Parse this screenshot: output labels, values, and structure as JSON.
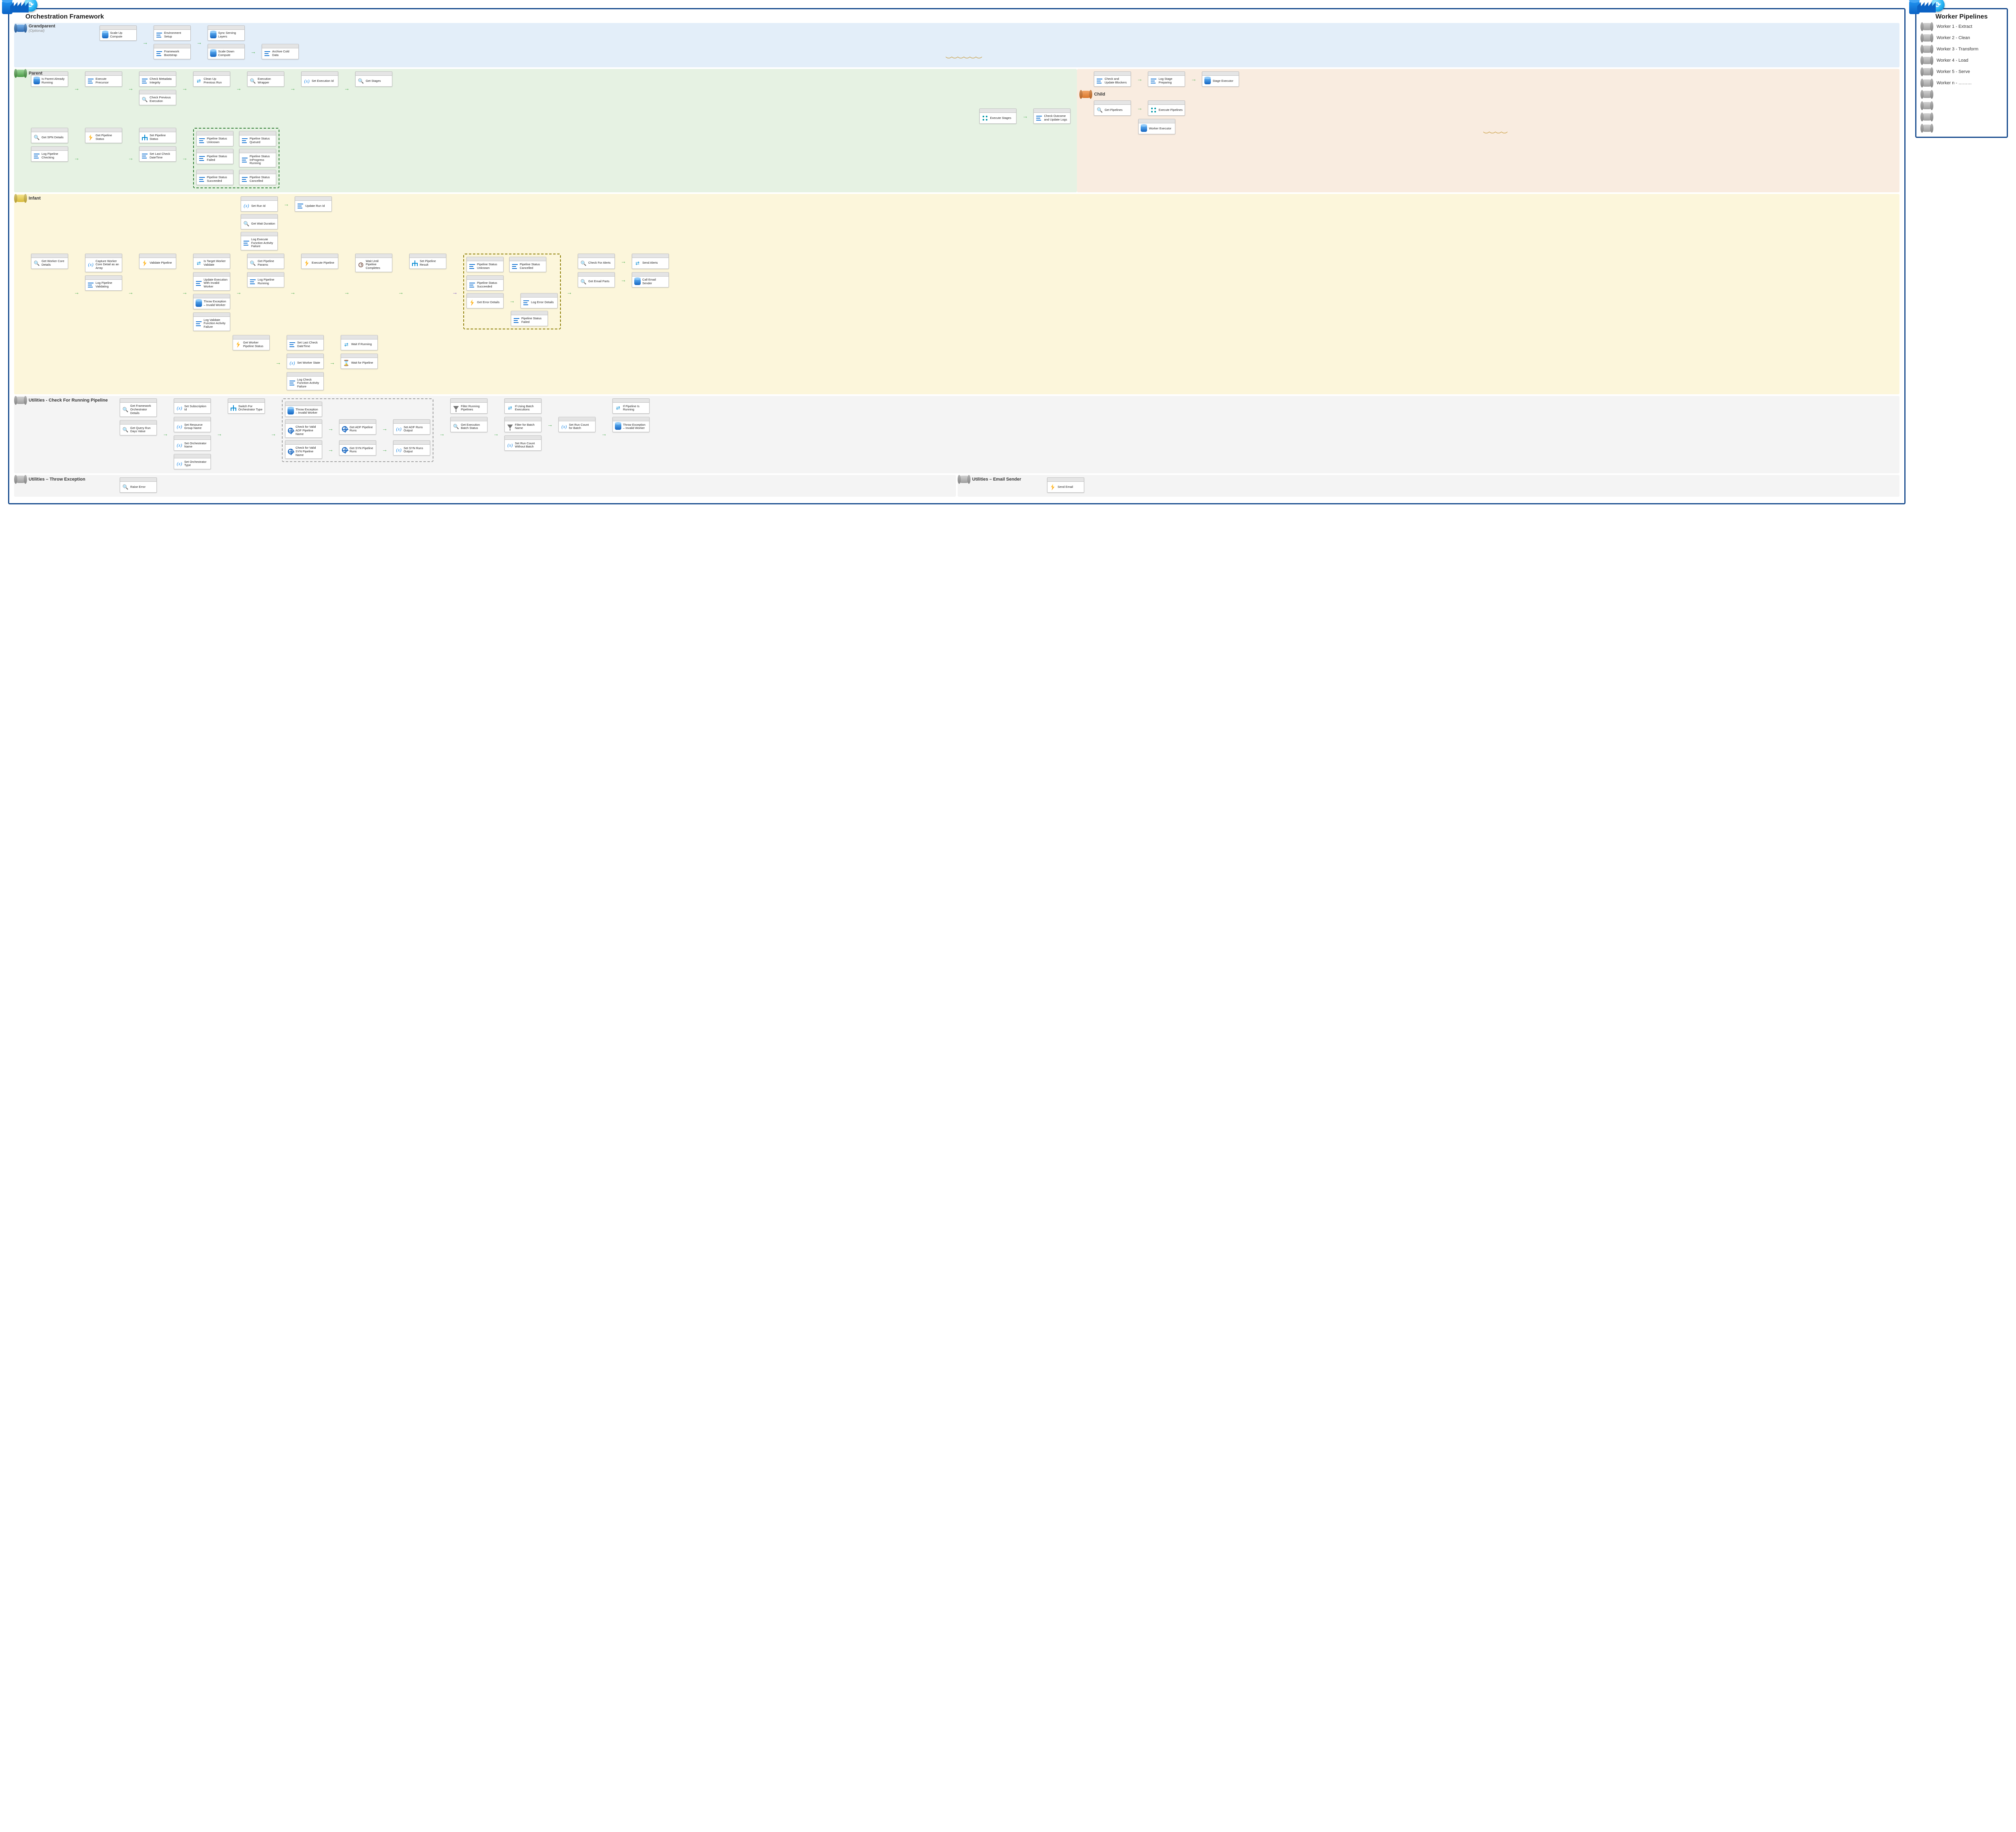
{
  "left_panel_title": "Orchestration Framework",
  "right_panel_title": "Worker Pipelines",
  "lanes": {
    "grandparent": {
      "title": "Grandparent",
      "subtitle": "(Optional)"
    },
    "parent": {
      "title": "Parent"
    },
    "child": {
      "title": "Child"
    },
    "infant": {
      "title": "Infant"
    },
    "util_running": {
      "title": "Utilities - Check For Running Pipeline"
    },
    "util_throw": {
      "title": "Utilities – Throw Exception"
    },
    "util_email": {
      "title": "Utilities – Email Sender"
    }
  },
  "act": {
    "scale_up": "Scale Up Compute",
    "env_setup": "Environment Setup",
    "framework_bootstrap": "Framework Bootstrap",
    "sync_serving": "Sync Serving Layers",
    "scale_down": "Scale Down Compute",
    "archive_cold": "Archive Cold Data",
    "is_parent_running": "Is Parent Already Running",
    "execute_precursor": "Execute Precursor",
    "check_metadata": "Check Metadata Integrity",
    "check_prev_exec": "Check Previous Execution",
    "cleanup_prev_run": "Clean Up Previous Run",
    "execution_wrapper": "Execution Wrapper",
    "set_exec_id": "Set Execution Id",
    "get_stages": "Get Stages",
    "execute_stages": "Execute Stages",
    "check_outcome": "Check Outcome and Update Logs",
    "get_spn": "Get SPN Details",
    "log_pipe_checking": "Log Pipeline Checking",
    "get_pipe_status": "Get Pipeline Status",
    "set_pipe_status": "Set Pipeline Status",
    "set_last_check_dt": "Set Last Check DateTime",
    "ps_unknown": "Pipeline Status Unknown",
    "ps_queued": "Pipeline Status Queued",
    "ps_failed": "Pipeline Status Failed",
    "ps_inprog": "Pipeline Status InProgress Running",
    "ps_succeeded": "Pipeline Status Succeeded",
    "ps_cancelled": "Pipeline Status Cancelled",
    "check_update_blockers": "Check and Update Blockers",
    "log_stage_preparing": "Log Stage Preparing",
    "stage_executor": "Stage Executor",
    "get_pipelines": "Get Pipelines",
    "execute_pipelines": "Execute Pipelines",
    "worker_executor": "Worker Executor",
    "get_worker_core": "Get Worker Core Details",
    "capture_worker_array": "Capture Worker Core Detail as an Array",
    "log_pipe_validating": "Log Pipeline Validating",
    "validate_pipeline": "Validate Pipeline",
    "is_target_worker_valid": "Is Target Worker Validate",
    "get_pipe_params": "Get Pipeline Params",
    "log_pipe_running": "Log Pipeline Running",
    "execute_pipeline": "Execute Pipeline",
    "update_exec_invalid": "Update Execution With Invalid Worker",
    "throw_invalid_worker": "Throw Exception – Invalid Worker",
    "log_validate_func_fail": "Log Validate Function Activity Failure",
    "set_run_id": "Set Run Id",
    "update_run_id": "Update Run Id",
    "get_wait_duration": "Get Wait Duration",
    "log_exec_func_fail": "Log Execute Function Activity Failure",
    "wait_until_complete": "Wait Until Pipeline Completes",
    "set_pipe_result": "Set Pipeline Result",
    "get_worker_pipe_status": "Get Worker Pipeline Status",
    "set_last_check_dt2": "Set Last Check DateTime",
    "set_worker_state": "Set Worker State",
    "wait_if_running": "Wait If Running",
    "wait_for_pipeline": "Wait for Pipeline",
    "log_check_func_fail": "Log Check Function Activity Failure",
    "ps_unknown2": "Pipeline Status Unknown",
    "ps_cancelled2": "Pipeline Status Cancelled",
    "ps_succeeded2": "Pipeline Status Succeeded",
    "get_error_details": "Get Error Details",
    "log_error_details": "Log Error Details",
    "ps_failed2": "Pipeline Status Failed",
    "check_for_alerts": "Check For Alerts",
    "send_alerts": "Send Alerts",
    "get_email_parts": "Get Email Parts",
    "call_email_sender": "Call Email Sender",
    "get_framework_orch": "Get Framework Orchestrator Details",
    "get_query_run_days": "Get Query Run Days Value",
    "set_subscription_id": "Set Subscription Id",
    "set_rg_name": "Set Resource Group Name",
    "set_orch_name": "Set Orchestrator Name",
    "set_orch_type": "Set Orchestrator Type",
    "switch_orch_type": "Switch For Orchestrator Type",
    "throw_invalid_worker2": "Throw Exception – Invalid Worker",
    "check_valid_adf_name": "Check for Valid ADF Pipeline Name",
    "get_adf_runs": "Get ADF Pipeline Runs",
    "set_adf_runs_out": "Set ADF Runs Output",
    "check_valid_syn_name": "Check for Valid SYN Pipeline Name",
    "get_syn_runs": "Get SYN Pipeline Runs",
    "set_syn_runs_out": "Set SYN Runs Output",
    "filter_running": "Filter Running Pipelines",
    "get_exec_batch_status": "Get Execution Batch Status",
    "if_using_batch": "If Using Batch Executions",
    "filter_batch_name": "Filter for Batch Name",
    "set_run_count_batch": "Set Run Count for Batch",
    "set_run_count_nobatch": "Set Run Count Without Batch",
    "if_pipeline_running": "If Pipeline Is Running",
    "throw_invalid_worker3": "Throw Exception – Invalid Worker",
    "raise_error": "Raise Error",
    "send_email": "Send Email"
  },
  "workers": [
    "Worker 1 - Extract",
    "Worker 2 - Clean",
    "Worker 3 - Transform",
    "Worker 4 - Load",
    "Worker 5 - Serve",
    "Worker n - ………"
  ]
}
